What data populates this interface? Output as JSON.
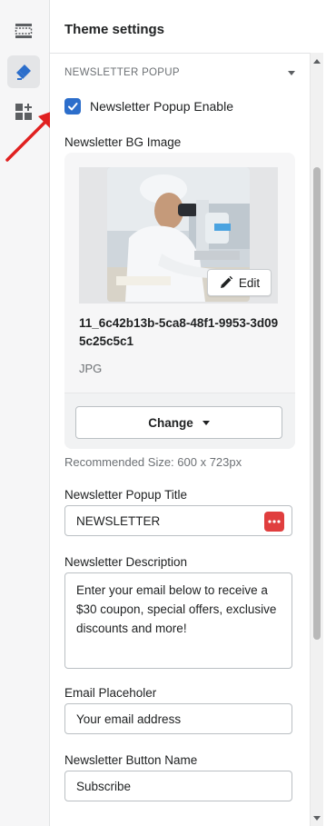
{
  "sidebar_rail": {
    "items": [
      {
        "icon": "section-layout-icon",
        "active": false
      },
      {
        "icon": "paint-brush-icon",
        "active": true
      },
      {
        "icon": "apps-add-icon",
        "active": false
      }
    ]
  },
  "panel": {
    "title": "Theme settings",
    "section_title": "NEWSLETTER POPUP",
    "enable_label": "Newsletter Popup Enable",
    "enable_checked": true,
    "bg_image_label": "Newsletter BG Image",
    "image": {
      "edit_label": "Edit",
      "file_name": "11_6c42b13b-5ca8-48f1-9953-3d095c25c5c1",
      "file_type": "JPG",
      "change_label": "Change"
    },
    "recommended_size": "Recommended Size: 600 x 723px",
    "popup_title_label": "Newsletter Popup Title",
    "popup_title_value": "NEWSLETTER",
    "description_label": "Newsletter Description",
    "description_value": "Enter your email below to receive a $30 coupon, special offers, exclusive discounts and more!",
    "email_placeholder_label": "Email Placeholer",
    "email_placeholder_value": "Your email address",
    "button_name_label": "Newsletter Button Name",
    "button_name_value": "Subscribe"
  },
  "colors": {
    "accent": "#2c6ecb",
    "annotation_arrow": "#e02020",
    "dots_button": "#e03e3e"
  }
}
